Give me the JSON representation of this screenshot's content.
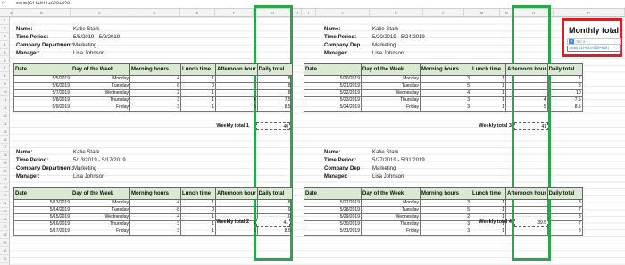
{
  "formula_bar": {
    "fx": "fx",
    "text": "=sum(G11+N11+G28+N28)"
  },
  "columns": [
    "A",
    "B",
    "C",
    "D",
    "E",
    "F",
    "G",
    "H",
    "I",
    "J",
    "K",
    "L",
    "M",
    "N",
    "O",
    "P"
  ],
  "rows": [
    "1",
    "2",
    "3",
    "4",
    "5",
    "6",
    "7",
    "8",
    "9",
    "10",
    "11",
    "12",
    "13",
    "14",
    "15",
    "16",
    "17",
    "18",
    "19",
    "20",
    "21",
    "22",
    "23",
    "24",
    "25",
    "26",
    "27",
    "28",
    "29",
    "30",
    "31"
  ],
  "labels": {
    "name": "Name:",
    "period": "Time Period:",
    "dept": "Company Department:",
    "dept_short": "Company Dep",
    "manager": "Manager:"
  },
  "headers": [
    "Date",
    "Day of the Week",
    "Morning hours",
    "Lunch time",
    "Afternoon hour",
    "Daily total"
  ],
  "blocks": [
    {
      "name": "Katie Stark",
      "period": "5/5/2019 - 5/9/2019",
      "dept": "Marketing",
      "manager": "Lisa Johnson",
      "rows": [
        [
          "5/5/2019",
          "Monday",
          "4",
          "1",
          "",
          "8"
        ],
        [
          "5/6/2019",
          "Tuesday",
          "8",
          "0",
          "",
          "8"
        ],
        [
          "5/7/2019",
          "Wednesday",
          "2",
          "1",
          "",
          "8"
        ],
        [
          "5/8/2019",
          "Thursday",
          "3",
          "1",
          "4",
          "7.5"
        ],
        [
          "5/9/2019",
          "Friday",
          "3",
          "1",
          "5",
          "8.5"
        ]
      ],
      "weekly_label": "Weekly total 1",
      "weekly_value": "40"
    },
    {
      "name": "Katie Stark",
      "period": "5/20/2019 - 5/24/2019",
      "dept": "Marketing",
      "manager": "Lisa Johnson",
      "rows": [
        [
          "5/20/2019",
          "Monday",
          "3",
          "1",
          "",
          "7"
        ],
        [
          "5/21/2019",
          "Tuesday",
          "5",
          "1",
          "",
          "8"
        ],
        [
          "5/22/2019",
          "Wednesday",
          "4",
          "1",
          "",
          "10"
        ],
        [
          "5/23/2019",
          "Thursday",
          "3",
          "1",
          "4",
          "7.5"
        ],
        [
          "5/24/2019",
          "Friday",
          "3",
          "1",
          "5",
          "8.5"
        ]
      ],
      "weekly_label": "Weekly total 3",
      "weekly_value": "41"
    },
    {
      "name": "Katie Stark",
      "period": "5/13/2019 - 5/17/2019",
      "dept": "Marketing",
      "manager": "Lisa Johnson",
      "rows": [
        [
          "5/13/2019",
          "Monday",
          "4",
          "1",
          "",
          "8"
        ],
        [
          "5/14/2019",
          "Tuesday",
          "8",
          "0",
          "",
          "9"
        ],
        [
          "5/15/2019",
          "Wednesday",
          "4",
          "1",
          "",
          "10"
        ],
        [
          "5/16/2019",
          "Thursday",
          "3",
          "1",
          "4",
          "5.5"
        ],
        [
          "5/17/2019",
          "Friday",
          "3",
          "1",
          "5",
          "8.5"
        ]
      ],
      "weekly_label": "Weekly total 2",
      "weekly_value": "41"
    },
    {
      "name": "Katie Stark",
      "period": "5/27/2019 - 5/31/2019",
      "dept": "Marketing",
      "manager": "Lisa Johnson",
      "rows": [
        [
          "5/27/2019",
          "Monday",
          "3",
          "1",
          "",
          "8"
        ],
        [
          "5/28/2019",
          "Tuesday",
          "5",
          "1",
          "",
          "7"
        ],
        [
          "5/29/2019",
          "Wednesday",
          "2",
          "1",
          "",
          "8"
        ],
        [
          "5/30/2019",
          "Thursday",
          "3",
          "1",
          "",
          "7"
        ],
        [
          "5/31/2019",
          "Friday",
          "3",
          "1",
          "",
          "8"
        ]
      ],
      "weekly_label": "Weekly total 4",
      "weekly_value": "39.5"
    }
  ],
  "monthly": {
    "title": "Monthly total",
    "tip_icon": "fx",
    "tip": "TBC X +",
    "formula": "=sum(G11+N11+G28+N28)"
  },
  "colors": {
    "highlight_green": "#2ea44f",
    "highlight_red": "#e01b24",
    "header_fill": "#d9ead3"
  }
}
